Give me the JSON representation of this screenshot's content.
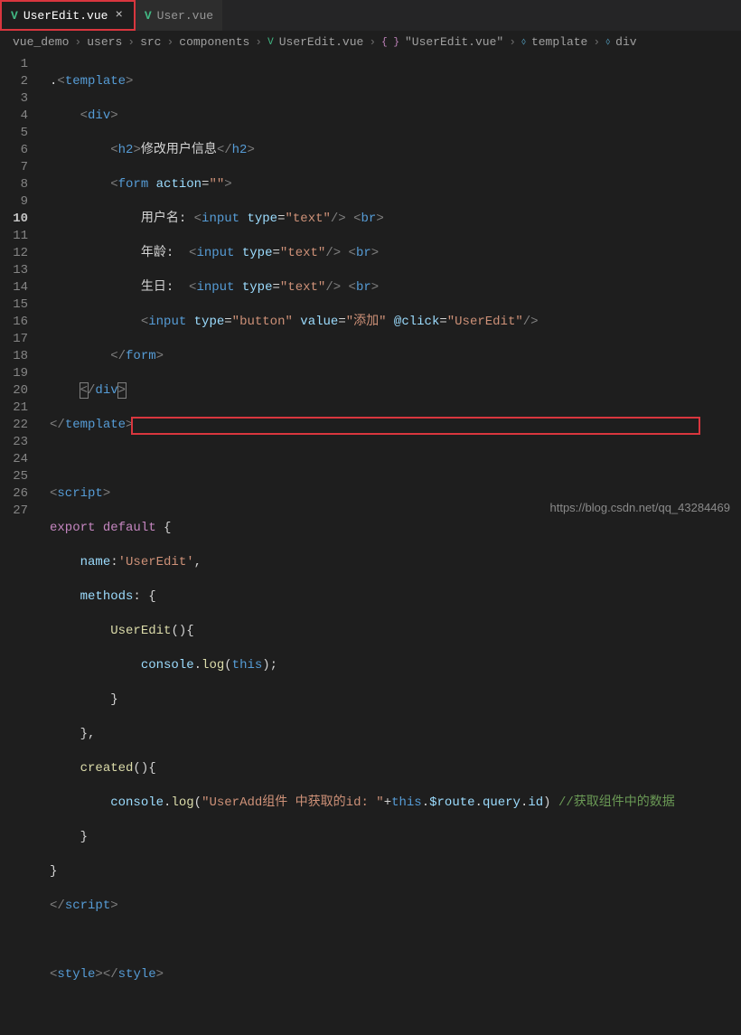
{
  "tabs": {
    "active": {
      "label": "UserEdit.vue"
    },
    "inactive": {
      "label": "User.vue"
    }
  },
  "breadcrumb": {
    "p0": "vue_demo",
    "p1": "users",
    "p2": "src",
    "p3": "components",
    "p4": "UserEdit.vue",
    "p5": "\"UserEdit.vue\"",
    "p6": "template",
    "p7": "div"
  },
  "lineNumbers": [
    "1",
    "2",
    "3",
    "4",
    "5",
    "6",
    "7",
    "8",
    "9",
    "10",
    "11",
    "12",
    "13",
    "14",
    "15",
    "16",
    "17",
    "18",
    "19",
    "20",
    "21",
    "22",
    "23",
    "24",
    "25",
    "26",
    "27"
  ],
  "code": {
    "l1a": ".",
    "l1b": "<",
    "l1c": "template",
    "l1d": ">",
    "l2a": "<",
    "l2b": "div",
    "l2c": ">",
    "l3a": "<",
    "l3b": "h2",
    "l3c": ">",
    "l3d": "修改用户信息",
    "l3e": "</",
    "l3f": "h2",
    "l3g": ">",
    "l4a": "<",
    "l4b": "form",
    "l4c": " action",
    "l4d": "=",
    "l4e": "\"\"",
    "l4f": ">",
    "l5a": "用户名: ",
    "l5b": "<",
    "l5c": "input",
    "l5d": " type",
    "l5e": "=",
    "l5f": "\"text\"",
    "l5g": "/> ",
    "l5h": "<",
    "l5i": "br",
    "l5j": ">",
    "l6a": "年龄:  ",
    "l6b": "<",
    "l6c": "input",
    "l6d": " type",
    "l6e": "=",
    "l6f": "\"text\"",
    "l6g": "/> ",
    "l6h": "<",
    "l6i": "br",
    "l6j": ">",
    "l7a": "生日:  ",
    "l7b": "<",
    "l7c": "input",
    "l7d": " type",
    "l7e": "=",
    "l7f": "\"text\"",
    "l7g": "/> ",
    "l7h": "<",
    "l7i": "br",
    "l7j": ">",
    "l8a": "<",
    "l8b": "input",
    "l8c": " type",
    "l8d": "=",
    "l8e": "\"button\"",
    "l8f": " value",
    "l8g": "=",
    "l8h": "\"添加\"",
    "l8i": " @click",
    "l8j": "=",
    "l8k": "\"UserEdit\"",
    "l8l": "/>",
    "l9a": "</",
    "l9b": "form",
    "l9c": ">",
    "l10a": "<",
    "l10b": "/",
    "l10c": "div",
    "l10d": ">",
    "l11a": "</",
    "l11b": "template",
    "l11c": ">",
    "l13a": "<",
    "l13b": "script",
    "l13c": ">",
    "l14a": "export",
    "l14b": " default",
    "l14c": " {",
    "l15a": "name",
    "l15b": ":",
    "l15c": "'UserEdit'",
    "l15d": ",",
    "l16a": "methods",
    "l16b": ": {",
    "l17a": "UserEdit",
    "l17b": "(){",
    "l18a": "console",
    "l18b": ".",
    "l18c": "log",
    "l18d": "(",
    "l18e": "this",
    "l18f": ");",
    "l19a": "}",
    "l20a": "},",
    "l21a": "created",
    "l21b": "(){",
    "l22a": "console",
    "l22b": ".",
    "l22c": "log",
    "l22d": "(",
    "l22e": "\"UserAdd组件 中获取的id: \"",
    "l22f": "+",
    "l22g": "this",
    "l22h": ".",
    "l22i": "$route",
    "l22j": ".",
    "l22k": "query",
    "l22l": ".",
    "l22m": "id",
    "l22n": ") ",
    "l22o": "//获取组件中的数据",
    "l23a": "}",
    "l24a": "}",
    "l25a": "</",
    "l25b": "script",
    "l25c": ">",
    "l27a": "<",
    "l27b": "style",
    "l27c": "></",
    "l27d": "style",
    "l27e": ">"
  },
  "watermark": "https://blog.csdn.net/qq_43284469"
}
